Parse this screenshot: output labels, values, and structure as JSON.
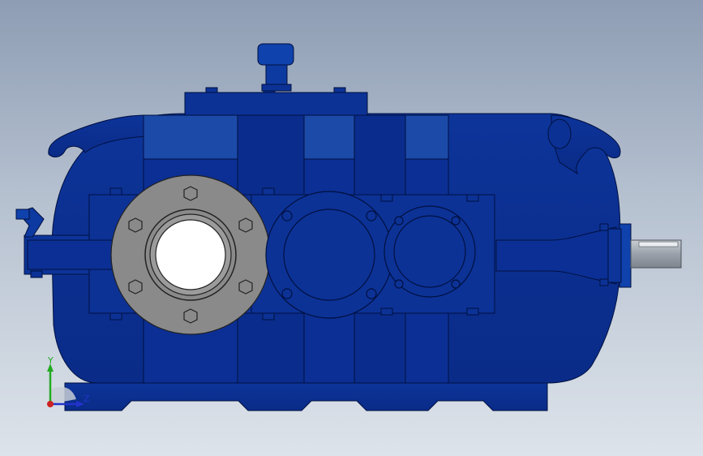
{
  "viewport": {
    "background_top": "#8e9db4",
    "background_bottom": "#dde3ea"
  },
  "model": {
    "body_color": "#0b2f94",
    "body_shade": "#16409f",
    "panel_light": "#1c4aa8",
    "outline_color": "#001040",
    "flange_color": "#8a8a8a",
    "flange_bore_color": "#ffffff",
    "shaft_color": "#a7adb5"
  },
  "triad": {
    "y_label": "Y",
    "z_label": "Z",
    "y_color": "#22aa22",
    "z_color": "#2233cc",
    "x_color": "#cc2222"
  }
}
